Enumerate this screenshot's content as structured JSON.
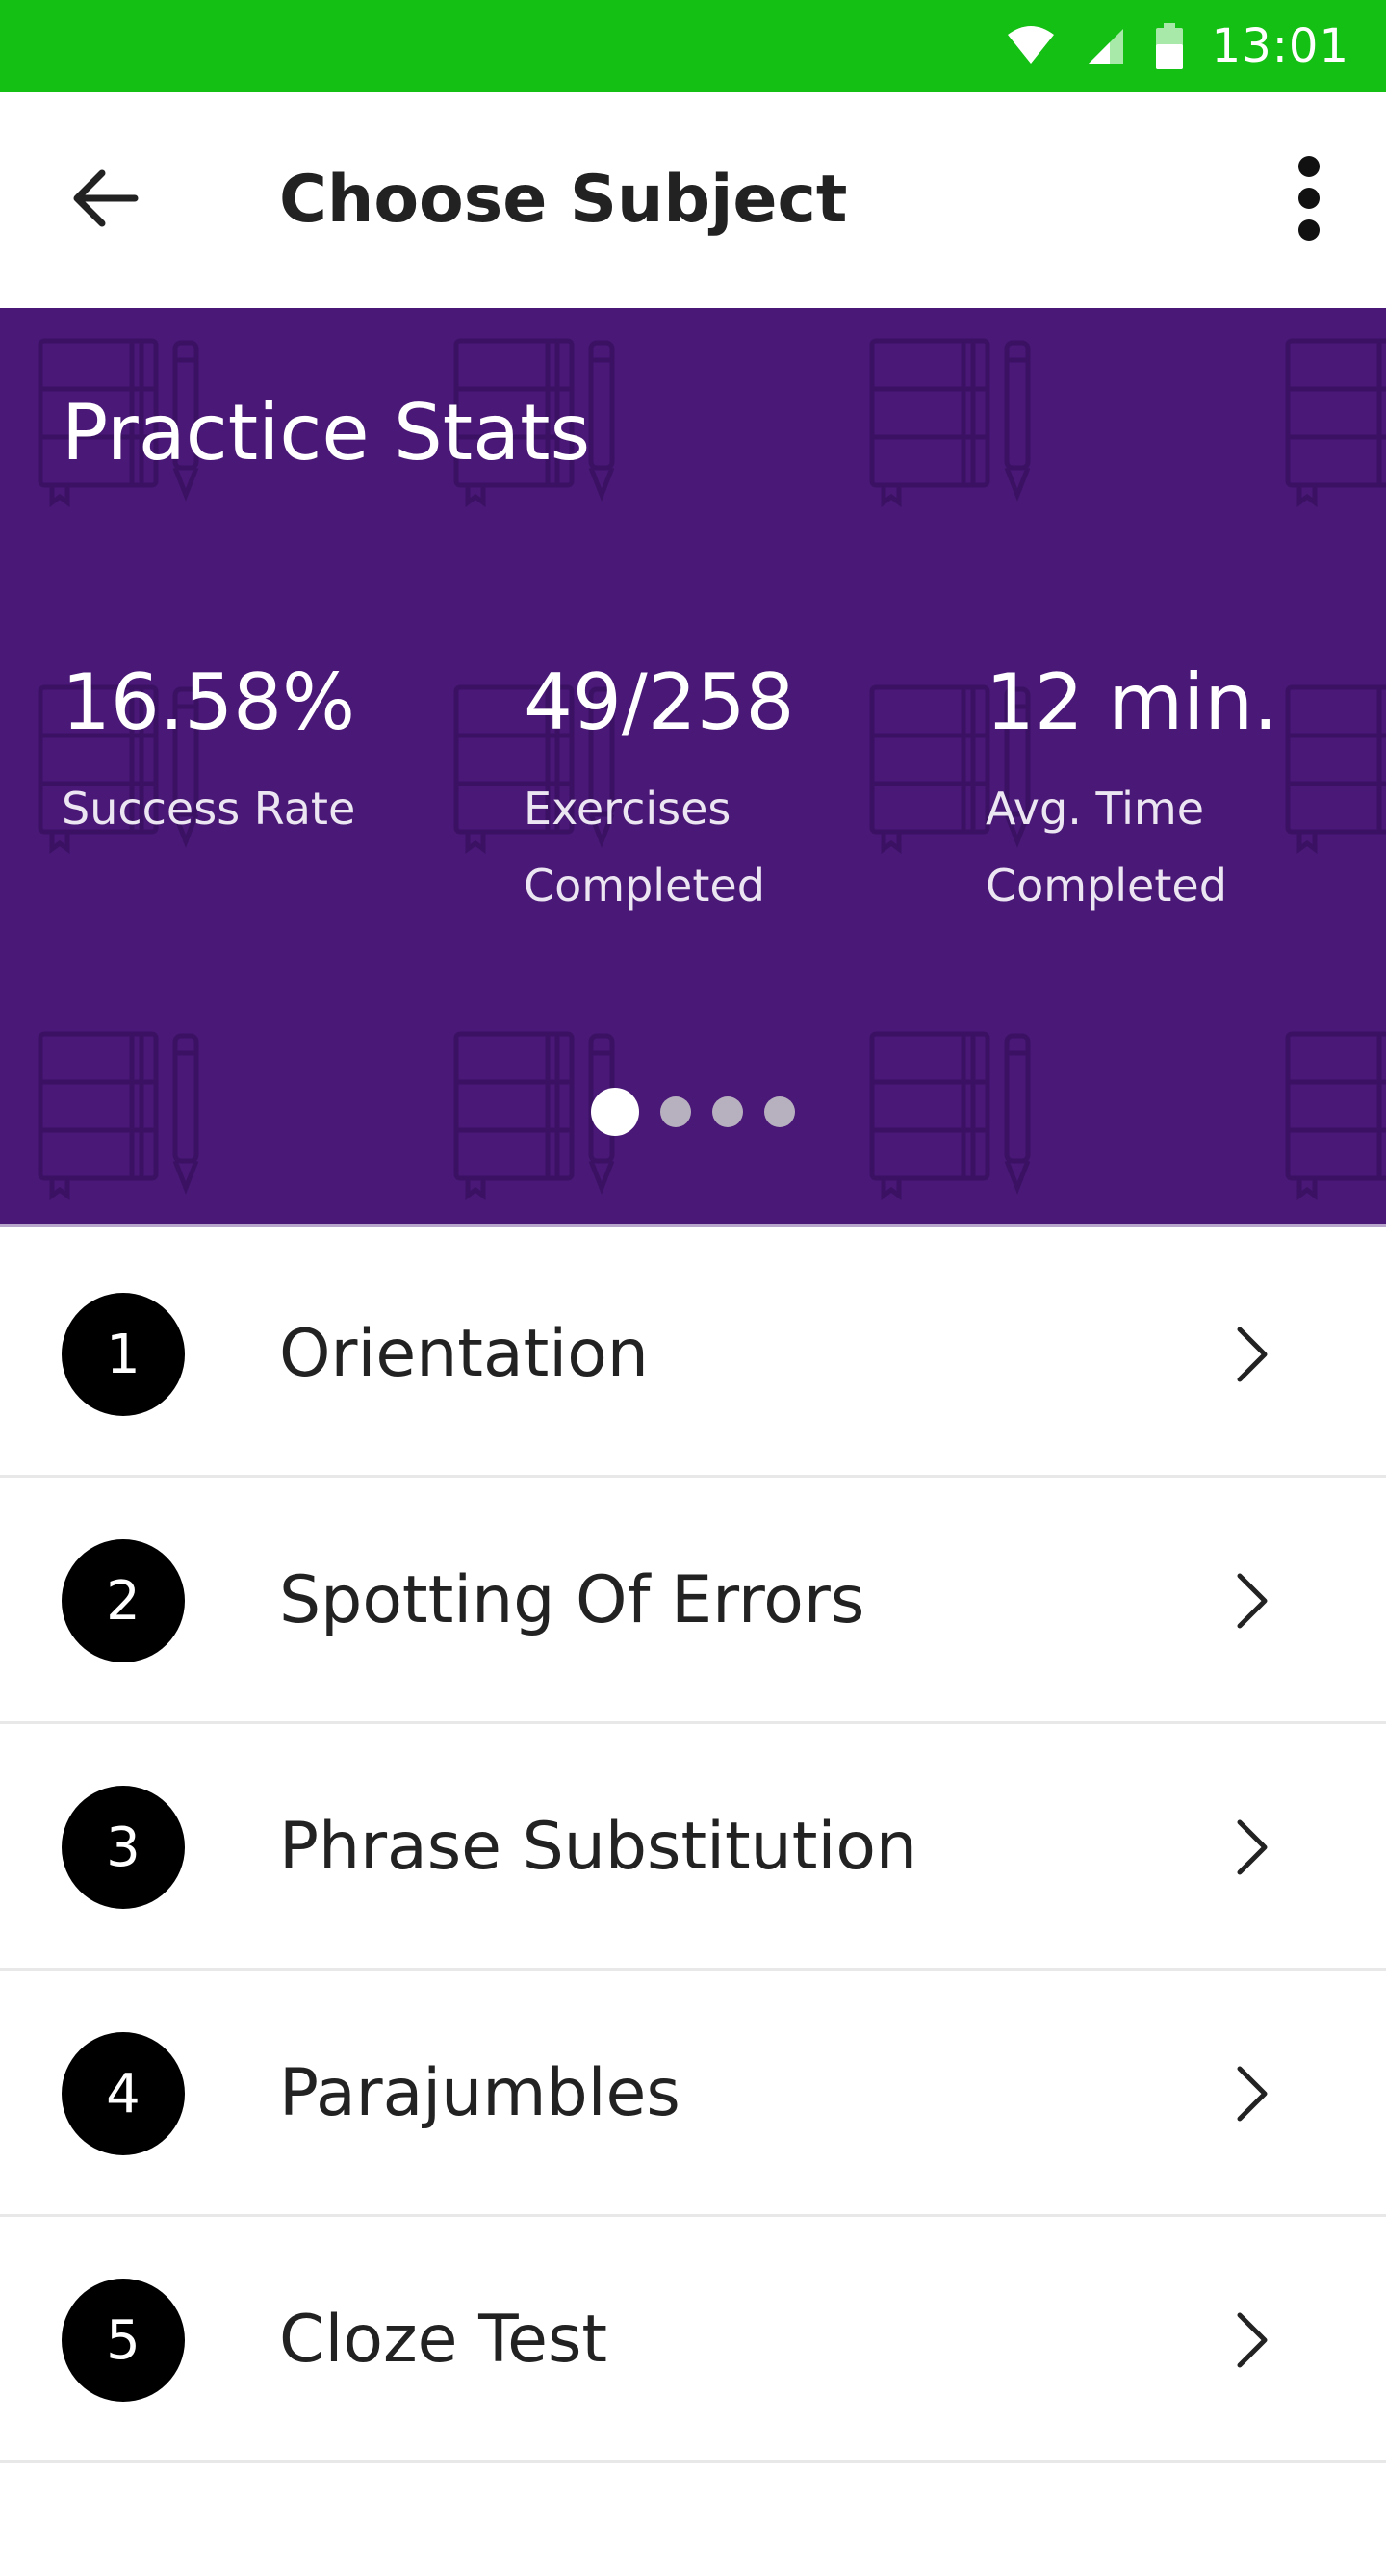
{
  "status_bar": {
    "time": "13:01",
    "icons": [
      "wifi-icon",
      "signal-icon",
      "battery-icon"
    ],
    "background_color": "#13c013"
  },
  "app_bar": {
    "title": "Choose Subject",
    "back_icon": "arrow-left-icon",
    "more_icon": "more-vertical-icon"
  },
  "stats": {
    "title": "Practice Stats",
    "background_color": "#4a1877",
    "items": [
      {
        "value": "16.58%",
        "label": "Success Rate"
      },
      {
        "value": "49/258",
        "label": "Exercises Completed"
      },
      {
        "value": "12 min.",
        "label": "Avg. Time Completed"
      }
    ],
    "pagination": {
      "total_pages": 4,
      "active_page": 1
    }
  },
  "subjects": [
    {
      "number": "1",
      "label": "Orientation"
    },
    {
      "number": "2",
      "label": "Spotting Of Errors"
    },
    {
      "number": "3",
      "label": "Phrase Substitution"
    },
    {
      "number": "4",
      "label": "Parajumbles"
    },
    {
      "number": "5",
      "label": "Cloze Test"
    }
  ]
}
